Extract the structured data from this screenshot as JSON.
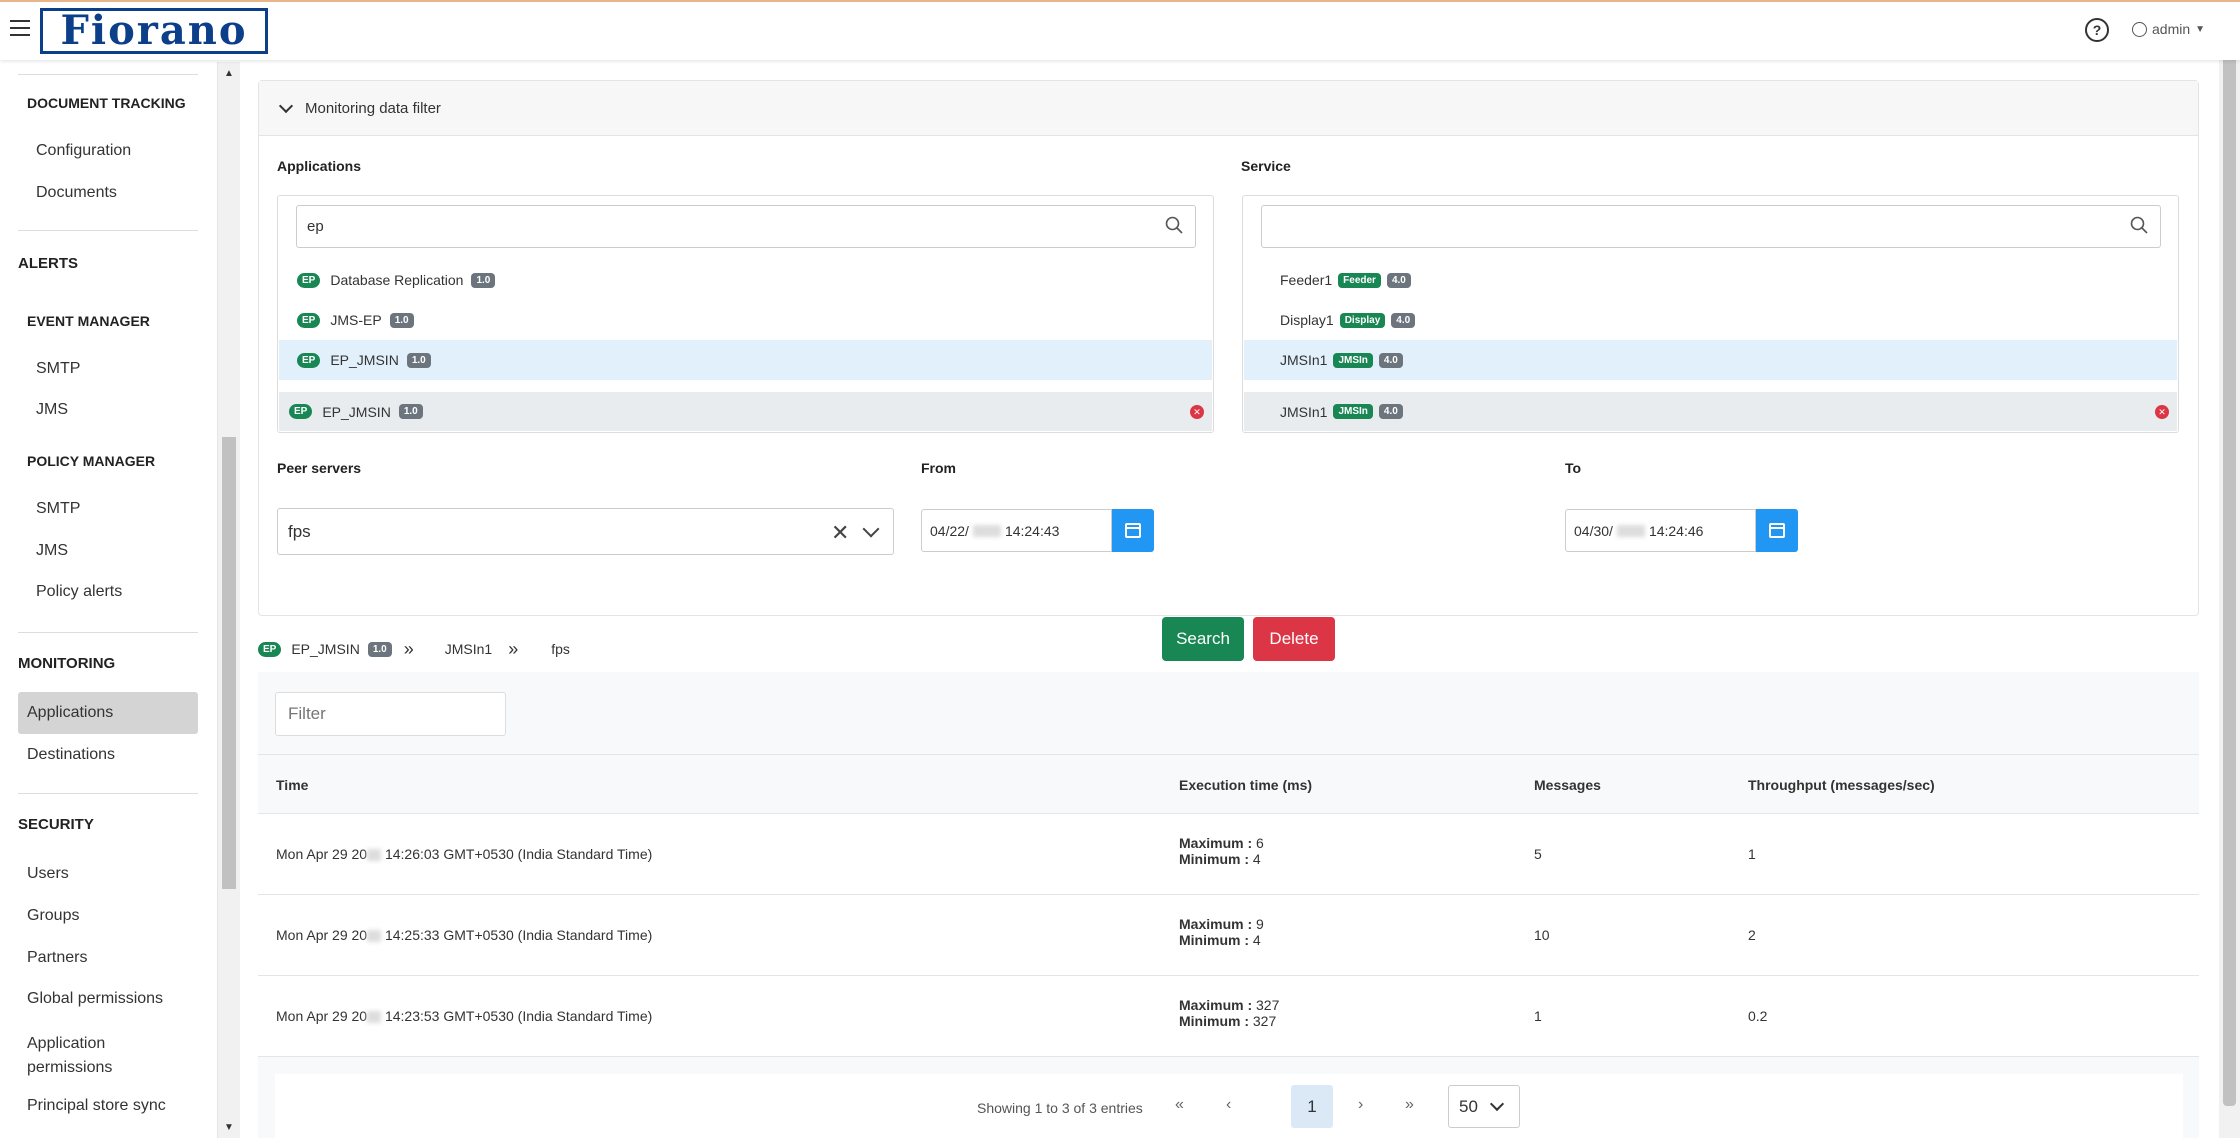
{
  "header": {
    "logo_text": "Fiorano",
    "help_icon": "question-circle-icon",
    "user_label": "admin"
  },
  "sidebar": {
    "document_tracking": {
      "title": "DOCUMENT TRACKING",
      "items": [
        "Configuration",
        "Documents"
      ]
    },
    "alerts": {
      "title": "ALERTS"
    },
    "event_manager": {
      "title": "EVENT MANAGER",
      "items": [
        "SMTP",
        "JMS"
      ]
    },
    "policy_manager": {
      "title": "POLICY MANAGER",
      "items": [
        "SMTP",
        "JMS",
        "Policy alerts"
      ]
    },
    "monitoring": {
      "title": "MONITORING",
      "items": [
        "Applications",
        "Destinations"
      ],
      "active": "Applications"
    },
    "security": {
      "title": "SECURITY",
      "items": [
        "Users",
        "Groups",
        "Partners",
        "Global permissions",
        "Application permissions",
        "Principal store sync"
      ]
    }
  },
  "filter": {
    "title": "Monitoring data filter",
    "applications_label": "Applications",
    "applications_search": "ep",
    "applications": [
      {
        "badge": "EP",
        "name": "Database Replication",
        "version": "1.0"
      },
      {
        "badge": "EP",
        "name": "JMS-EP",
        "version": "1.0"
      },
      {
        "badge": "EP",
        "name": "EP_JMSIN",
        "version": "1.0"
      }
    ],
    "selected_application": {
      "badge": "EP",
      "name": "EP_JMSIN",
      "version": "1.0"
    },
    "service_label": "Service",
    "service_search": "",
    "services": [
      {
        "name": "Feeder1",
        "tag": "Feeder",
        "version": "4.0"
      },
      {
        "name": "Display1",
        "tag": "Display",
        "version": "4.0"
      },
      {
        "name": "JMSIn1",
        "tag": "JMSIn",
        "version": "4.0"
      }
    ],
    "selected_service": {
      "name": "JMSIn1",
      "tag": "JMSIn",
      "version": "4.0"
    },
    "peer_label": "Peer servers",
    "peer_value": "fps",
    "from_label": "From",
    "from_prefix": "04/22/",
    "from_time": "14:24:43",
    "to_label": "To",
    "to_prefix": "04/30/",
    "to_time": "14:24:46",
    "search_button": "Search",
    "delete_button": "Delete"
  },
  "breadcrumb": {
    "badge": "EP",
    "app": "EP_JMSIN",
    "version": "1.0",
    "service": "JMSIn1",
    "peer": "fps"
  },
  "table": {
    "filter_placeholder": "Filter",
    "headers": [
      "Time",
      "Execution time (ms)",
      "Messages",
      "Throughput (messages/sec)"
    ],
    "max_label": "Maximum :",
    "min_label": "Minimum :",
    "rows": [
      {
        "time_prefix": "Mon Apr 29 20",
        "time_suffix": " 14:26:03 GMT+0530 (India Standard Time)",
        "max": "6",
        "min": "4",
        "messages": "5",
        "throughput": "1"
      },
      {
        "time_prefix": "Mon Apr 29 20",
        "time_suffix": " 14:25:33 GMT+0530 (India Standard Time)",
        "max": "9",
        "min": "4",
        "messages": "10",
        "throughput": "2"
      },
      {
        "time_prefix": "Mon Apr 29 20",
        "time_suffix": " 14:23:53 GMT+0530 (India Standard Time)",
        "max": "327",
        "min": "327",
        "messages": "1",
        "throughput": "0.2"
      }
    ]
  },
  "pagination": {
    "info": "Showing 1 to 3 of 3 entries",
    "current_page": "1",
    "page_size": "50"
  },
  "colors": {
    "brand": "#0b3f8a",
    "success": "#198754",
    "danger": "#dc3545",
    "primary": "#2196f3",
    "selected_row": "#e2f0fb"
  }
}
